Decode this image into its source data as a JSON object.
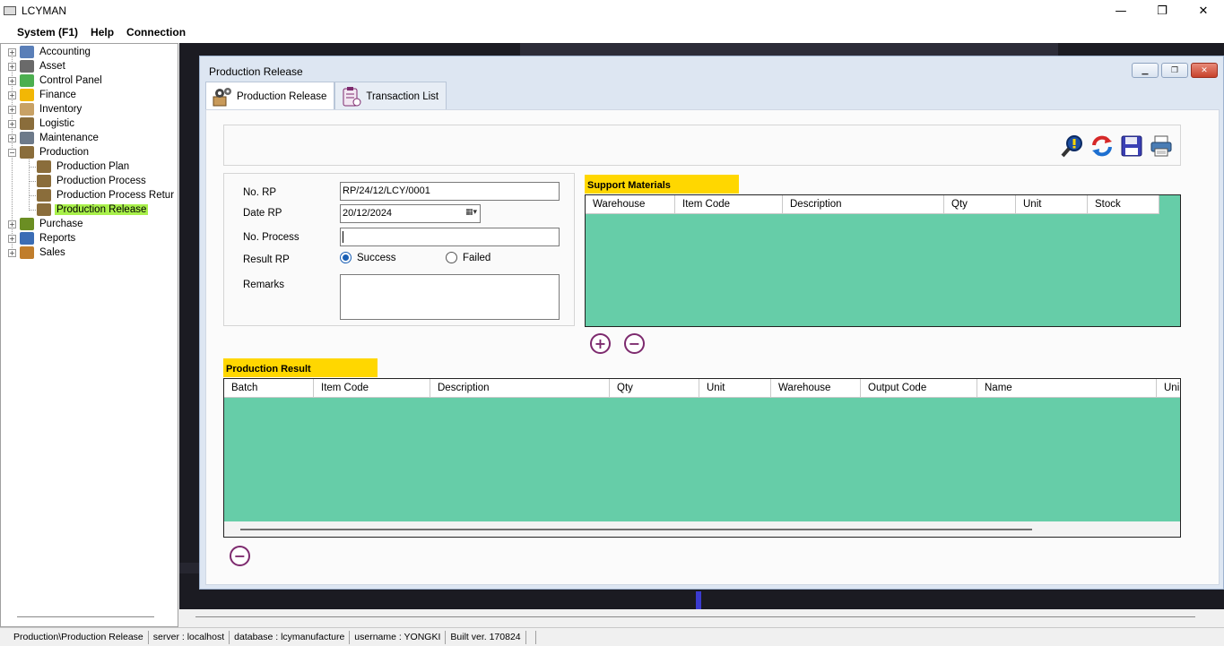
{
  "window": {
    "title": "LCYMAN",
    "min": "—",
    "max": "❐",
    "close": "✕"
  },
  "menu": [
    "System (F1)",
    "Help",
    "Connection"
  ],
  "tree": {
    "items": [
      {
        "label": "Accounting",
        "expander": "+",
        "color": "#5a7fb8"
      },
      {
        "label": "Asset",
        "expander": "+",
        "color": "#6a6a6a"
      },
      {
        "label": "Control Panel",
        "expander": "+",
        "color": "#4caf50"
      },
      {
        "label": "Finance",
        "expander": "+",
        "color": "#f2b705"
      },
      {
        "label": "Inventory",
        "expander": "+",
        "color": "#c8a165"
      },
      {
        "label": "Logistic",
        "expander": "+",
        "color": "#8a6d3b"
      },
      {
        "label": "Maintenance",
        "expander": "+",
        "color": "#6d7a8a"
      },
      {
        "label": "Production",
        "expander": "−",
        "color": "#8a6d3b"
      },
      {
        "label": "Production Plan",
        "child": true,
        "color": "#8a6d3b"
      },
      {
        "label": "Production Process",
        "child": true,
        "color": "#8a6d3b"
      },
      {
        "label": "Production Process Retur",
        "child": true,
        "color": "#8a6d3b"
      },
      {
        "label": "Production Release",
        "child": true,
        "selected": true,
        "color": "#8a6d3b"
      },
      {
        "label": "Purchase",
        "expander": "+",
        "color": "#6b8e23"
      },
      {
        "label": "Reports",
        "expander": "+",
        "color": "#3b6db5"
      },
      {
        "label": "Sales",
        "expander": "+",
        "color": "#c07d2c"
      }
    ]
  },
  "child": {
    "title": "Production Release",
    "buttons": {
      "min": "▁",
      "restore": "❐",
      "close": "✕"
    },
    "tabs": [
      {
        "label": "Production Release",
        "icon": "gears-box-icon"
      },
      {
        "label": "Transaction List",
        "icon": "clipboard-list-icon"
      }
    ],
    "toolbar": [
      "search-icon",
      "refresh-icon",
      "save-icon",
      "print-icon"
    ],
    "form": {
      "no_rp_label": "No. RP",
      "no_rp_value": "RP/24/12/LCY/0001",
      "date_label": "Date RP",
      "date_value": "20/12/2024",
      "no_process_label": "No. Process",
      "no_process_value": "",
      "result_label": "Result RP",
      "result_success": "Success",
      "result_failed": "Failed",
      "result_selected": "Success",
      "remarks_label": "Remarks",
      "remarks_value": ""
    },
    "support": {
      "title": "Support Materials",
      "columns": [
        "Warehouse",
        "Item Code",
        "Description",
        "Qty",
        "Unit",
        "Stock"
      ],
      "add": "+",
      "remove": "−"
    },
    "result": {
      "title": "Production Result",
      "columns": [
        "Batch",
        "Item Code",
        "Description",
        "Qty",
        "Unit",
        "Warehouse",
        "Output Code",
        "Name",
        "Uni"
      ],
      "remove": "−"
    }
  },
  "status": [
    "Production\\Production Release",
    "server : localhost",
    "database : lcymanufacture",
    "username : YONGKI",
    "Built ver. 170824"
  ],
  "colors": {
    "grid": "#66cda8",
    "section": "#ffd700",
    "selected": "#a8f04a"
  }
}
